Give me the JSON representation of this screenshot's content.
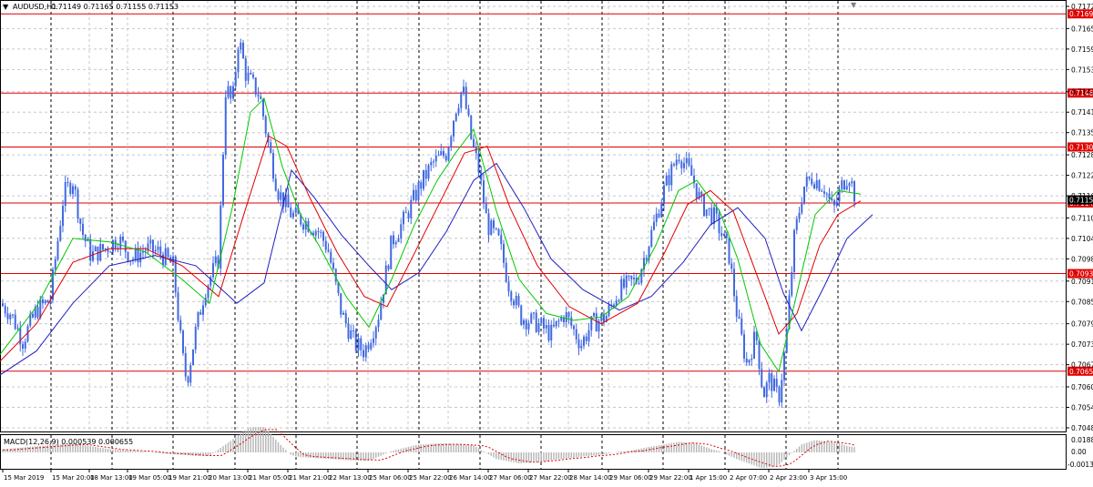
{
  "header": {
    "symbol_timeframe": "AUDUSD,H1",
    "ohlc": "0.71149 0.71165 0.71155 0.71153"
  },
  "macd_panel": {
    "label": "MACD(12,26,9) 0.000539 0.000655",
    "ticks": [
      "0.0188",
      "0.00",
      "-0.00132"
    ]
  },
  "colors": {
    "background": "#ffffff",
    "grid": "#c8c8c8",
    "candles": "#4169e1",
    "ma_fast": "#00c800",
    "ma_mid": "#e00000",
    "ma_slow": "#2020c0",
    "levels": "#e00000",
    "level_label_bg": "#e00000",
    "macd_signal": "#e00000",
    "macd_hist": "#b4b4b4"
  },
  "chart_data": {
    "type": "candlestick",
    "symbol": "AUDUSD",
    "timeframe": "H1",
    "ylim": [
      0.70485,
      0.7172
    ],
    "y_ticks": [
      "0.71720",
      "0.71655",
      "0.71595",
      "0.71535",
      "0.71470",
      "0.71410",
      "0.71350",
      "0.71285",
      "0.71225",
      "0.71165",
      "0.71100",
      "0.71040",
      "0.70980",
      "0.70915",
      "0.70855",
      "0.70790",
      "0.70730",
      "0.70670",
      "0.70605",
      "0.70545",
      "0.70485"
    ],
    "current_price": "0.71153",
    "x_ticks": [
      "15 Mar 2019",
      "15 Mar 20:00",
      "18 Mar 13:00",
      "19 Mar 05:00",
      "19 Mar 21:00",
      "20 Mar 13:00",
      "21 Mar 05:00",
      "21 Mar 21:00",
      "22 Mar 13:00",
      "25 Mar 06:00",
      "25 Mar 22:00",
      "26 Mar 14:00",
      "27 Mar 06:00",
      "27 Mar 22:00",
      "28 Mar 14:00",
      "29 Mar 06:00",
      "29 Mar 22:00",
      "1 Apr 15:00",
      "2 Apr 07:00",
      "2 Apr 23:00",
      "3 Apr 15:00"
    ],
    "levels": [
      {
        "label": "0.71698",
        "value": 0.71698
      },
      {
        "label": "0.71466",
        "value": 0.71466
      },
      {
        "label": "0.71308",
        "value": 0.71308
      },
      {
        "label": "0.71144",
        "value": 0.71144
      },
      {
        "label": "0.70937",
        "value": 0.70937
      },
      {
        "label": "0.70651",
        "value": 0.70651
      }
    ],
    "price_path": [
      [
        0,
        0.7085
      ],
      [
        12,
        0.7082
      ],
      [
        25,
        0.7074
      ],
      [
        40,
        0.7083
      ],
      [
        55,
        0.7086
      ],
      [
        70,
        0.7117
      ],
      [
        80,
        0.7121
      ],
      [
        90,
        0.7106
      ],
      [
        100,
        0.7099
      ],
      [
        115,
        0.7101
      ],
      [
        130,
        0.7104
      ],
      [
        145,
        0.7098
      ],
      [
        160,
        0.7101
      ],
      [
        175,
        0.71
      ],
      [
        190,
        0.7096
      ],
      [
        200,
        0.707
      ],
      [
        205,
        0.7062
      ],
      [
        215,
        0.7077
      ],
      [
        225,
        0.7089
      ],
      [
        240,
        0.7098
      ],
      [
        248,
        0.7149
      ],
      [
        255,
        0.7143
      ],
      [
        262,
        0.7163
      ],
      [
        270,
        0.7152
      ],
      [
        285,
        0.7146
      ],
      [
        295,
        0.7131
      ],
      [
        305,
        0.7118
      ],
      [
        320,
        0.7111
      ],
      [
        335,
        0.7109
      ],
      [
        350,
        0.7106
      ],
      [
        360,
        0.7101
      ],
      [
        375,
        0.7082
      ],
      [
        390,
        0.7073
      ],
      [
        400,
        0.7071
      ],
      [
        415,
        0.7081
      ],
      [
        430,
        0.7103
      ],
      [
        445,
        0.711
      ],
      [
        460,
        0.7119
      ],
      [
        475,
        0.7126
      ],
      [
        490,
        0.7129
      ],
      [
        500,
        0.7142
      ],
      [
        508,
        0.7148
      ],
      [
        518,
        0.7132
      ],
      [
        525,
        0.7125
      ],
      [
        535,
        0.7108
      ],
      [
        548,
        0.7103
      ],
      [
        558,
        0.7091
      ],
      [
        572,
        0.7081
      ],
      [
        590,
        0.7079
      ],
      [
        605,
        0.7076
      ],
      [
        620,
        0.7082
      ],
      [
        638,
        0.7073
      ],
      [
        650,
        0.7079
      ],
      [
        665,
        0.7081
      ],
      [
        680,
        0.7089
      ],
      [
        700,
        0.7092
      ],
      [
        718,
        0.7108
      ],
      [
        730,
        0.7119
      ],
      [
        745,
        0.7129
      ],
      [
        760,
        0.7122
      ],
      [
        770,
        0.7114
      ],
      [
        785,
        0.711
      ],
      [
        800,
        0.71
      ],
      [
        810,
        0.708
      ],
      [
        820,
        0.7067
      ],
      [
        830,
        0.7076
      ],
      [
        838,
        0.7058
      ],
      [
        845,
        0.7063
      ],
      [
        855,
        0.7057
      ],
      [
        863,
        0.7074
      ],
      [
        872,
        0.7104
      ],
      [
        882,
        0.7119
      ],
      [
        892,
        0.7122
      ],
      [
        905,
        0.7119
      ],
      [
        915,
        0.7112
      ],
      [
        925,
        0.712
      ],
      [
        932,
        0.7123
      ],
      [
        940,
        0.7115
      ]
    ],
    "ma_fast_path": [
      [
        0,
        0.707
      ],
      [
        40,
        0.7084
      ],
      [
        80,
        0.7104
      ],
      [
        120,
        0.7103
      ],
      [
        160,
        0.71
      ],
      [
        200,
        0.7092
      ],
      [
        230,
        0.7085
      ],
      [
        255,
        0.7113
      ],
      [
        275,
        0.7141
      ],
      [
        290,
        0.7145
      ],
      [
        310,
        0.7125
      ],
      [
        330,
        0.7111
      ],
      [
        350,
        0.7102
      ],
      [
        380,
        0.7087
      ],
      [
        405,
        0.7078
      ],
      [
        430,
        0.7092
      ],
      [
        455,
        0.7108
      ],
      [
        480,
        0.7121
      ],
      [
        500,
        0.7129
      ],
      [
        520,
        0.7136
      ],
      [
        545,
        0.7112
      ],
      [
        570,
        0.7092
      ],
      [
        600,
        0.7082
      ],
      [
        630,
        0.708
      ],
      [
        660,
        0.7081
      ],
      [
        690,
        0.7087
      ],
      [
        720,
        0.7102
      ],
      [
        745,
        0.7118
      ],
      [
        765,
        0.7121
      ],
      [
        790,
        0.7112
      ],
      [
        810,
        0.7098
      ],
      [
        835,
        0.7073
      ],
      [
        855,
        0.7065
      ],
      [
        875,
        0.7088
      ],
      [
        895,
        0.7111
      ],
      [
        920,
        0.7118
      ],
      [
        945,
        0.7117
      ]
    ],
    "ma_mid_path": [
      [
        0,
        0.7068
      ],
      [
        40,
        0.7079
      ],
      [
        80,
        0.7097
      ],
      [
        120,
        0.7101
      ],
      [
        160,
        0.7101
      ],
      [
        200,
        0.7096
      ],
      [
        240,
        0.7087
      ],
      [
        270,
        0.7113
      ],
      [
        295,
        0.7134
      ],
      [
        315,
        0.7131
      ],
      [
        340,
        0.7116
      ],
      [
        370,
        0.71
      ],
      [
        400,
        0.7087
      ],
      [
        425,
        0.7084
      ],
      [
        450,
        0.7097
      ],
      [
        480,
        0.7113
      ],
      [
        510,
        0.7129
      ],
      [
        535,
        0.7131
      ],
      [
        560,
        0.7113
      ],
      [
        590,
        0.7096
      ],
      [
        625,
        0.7084
      ],
      [
        660,
        0.7079
      ],
      [
        700,
        0.7085
      ],
      [
        730,
        0.71
      ],
      [
        755,
        0.7114
      ],
      [
        780,
        0.7118
      ],
      [
        805,
        0.7112
      ],
      [
        830,
        0.7094
      ],
      [
        855,
        0.7076
      ],
      [
        875,
        0.7082
      ],
      [
        900,
        0.7102
      ],
      [
        920,
        0.7111
      ],
      [
        945,
        0.7115
      ]
    ],
    "ma_slow_path": [
      [
        0,
        0.7064
      ],
      [
        40,
        0.7071
      ],
      [
        80,
        0.7085
      ],
      [
        120,
        0.7096
      ],
      [
        170,
        0.7099
      ],
      [
        215,
        0.7096
      ],
      [
        260,
        0.7085
      ],
      [
        290,
        0.7091
      ],
      [
        320,
        0.7124
      ],
      [
        345,
        0.7116
      ],
      [
        375,
        0.7105
      ],
      [
        405,
        0.7096
      ],
      [
        430,
        0.7089
      ],
      [
        460,
        0.7094
      ],
      [
        490,
        0.7106
      ],
      [
        520,
        0.7121
      ],
      [
        545,
        0.7126
      ],
      [
        575,
        0.7113
      ],
      [
        605,
        0.7098
      ],
      [
        640,
        0.7089
      ],
      [
        680,
        0.7083
      ],
      [
        715,
        0.7087
      ],
      [
        750,
        0.7097
      ],
      [
        780,
        0.7108
      ],
      [
        810,
        0.7113
      ],
      [
        840,
        0.7104
      ],
      [
        860,
        0.7088
      ],
      [
        880,
        0.7077
      ],
      [
        905,
        0.709
      ],
      [
        930,
        0.7104
      ],
      [
        958,
        0.7111
      ]
    ]
  }
}
